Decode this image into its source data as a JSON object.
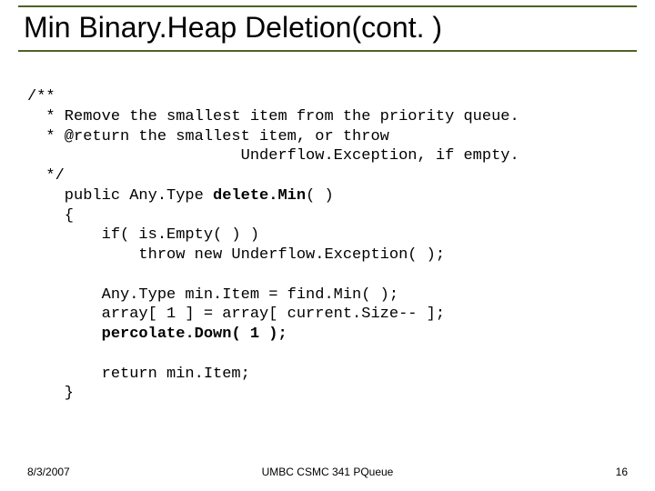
{
  "title": "Min Binary.Heap Deletion(cont. )",
  "code": {
    "l1": "/**",
    "l2": "  * Remove the smallest item from the priority queue.",
    "l3": "  * @return the smallest item, or throw",
    "l4": "                       Underflow.Exception, if empty.",
    "l5": "  */",
    "l6a": "    public Any.Type ",
    "l6b": "delete.Min",
    "l6c": "( )",
    "l7": "    {",
    "l8": "        if( is.Empty( ) )",
    "l9": "            throw new Underflow.Exception( );",
    "l10": "",
    "l11": "        Any.Type min.Item = find.Min( );",
    "l12": "        array[ 1 ] = array[ current.Size-- ];",
    "l13a": "        ",
    "l13b": "percolate.Down( 1 );",
    "l14": "",
    "l15": "        return min.Item;",
    "l16": "    }"
  },
  "footer": {
    "date": "8/3/2007",
    "center": "UMBC CSMC 341 PQueue",
    "pagenum": "16"
  }
}
